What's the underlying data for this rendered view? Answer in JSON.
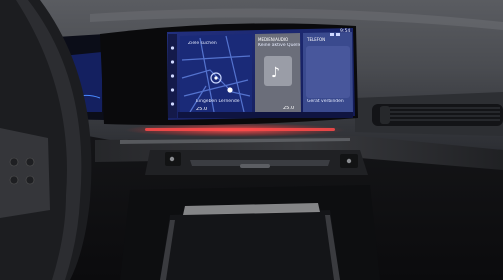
{
  "screen": {
    "status_time": "9:54",
    "nav_tile": {
      "label": "Ziele suchen",
      "destination": "Eingeben Lernende",
      "temperature": "25.0"
    },
    "media_tile": {
      "header": "MEDIEN/AUDIO",
      "line": "Keine aktive Quelle",
      "temperature": "25.0"
    },
    "phone_tile": {
      "header": "TELEFON",
      "line": "Gerät verbinden"
    }
  },
  "colors": {
    "screen_bg": "#1a2470",
    "map_lines": "#5b7bd8",
    "ambient_light": "#ff4a4a",
    "media_tile": "#6b6e7a",
    "phone_tile": "#3a4a8e"
  }
}
